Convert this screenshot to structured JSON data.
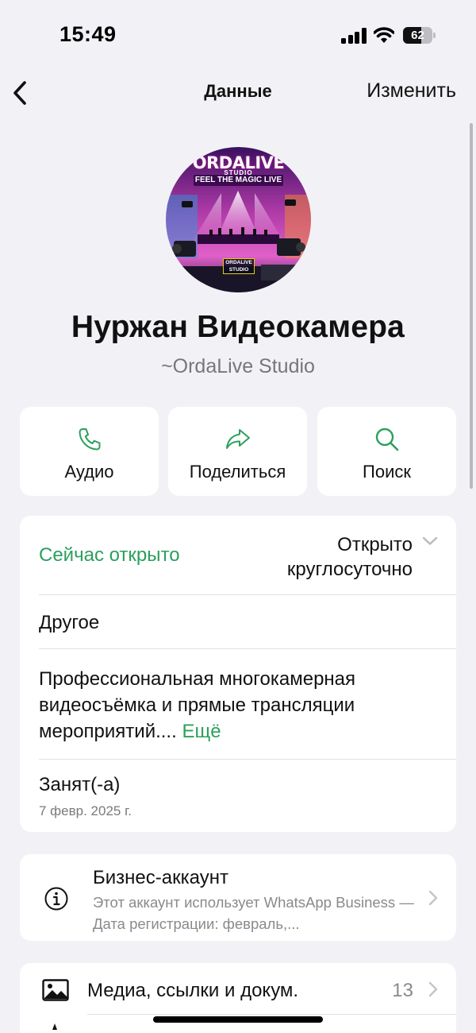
{
  "status_bar": {
    "time": "15:49",
    "battery_level": "62",
    "battery_fraction": 0.62
  },
  "nav": {
    "title": "Данные",
    "edit_label": "Изменить"
  },
  "avatar": {
    "logo_text": "ORDALIVE",
    "logo_sub": "STUDIO",
    "tagline": "FEEL THE MAGIC LIVE",
    "badge_line1": "ORDALIVE",
    "badge_line2": "STUDIO"
  },
  "contact": {
    "name": "Нуржан Видеокамера",
    "subtitle": "~OrdaLive Studio"
  },
  "actions": [
    {
      "label": "Аудио",
      "icon": "phone-icon"
    },
    {
      "label": "Поделиться",
      "icon": "share-icon"
    },
    {
      "label": "Поиск",
      "icon": "search-icon"
    }
  ],
  "info": {
    "open_status": "Сейчас открыто",
    "hours_line1": "Открыто",
    "hours_line2": "круглосуточно",
    "category": "Другое",
    "description": "Профессиональная многокамерная видеосъёмка и прямые трансляции мероприятий....",
    "more_label": "Ещё",
    "busy_label": "Занят(-а)",
    "busy_date": "7 февр. 2025 г."
  },
  "business": {
    "title": "Бизнес-аккаунт",
    "text": "Этот аккаунт использует WhatsApp Business — Дата регистрации: февраль,..."
  },
  "media": {
    "label": "Медиа, ссылки и докум.",
    "count": "13"
  },
  "colors": {
    "accent": "#2c9f5c",
    "background": "#f2f2f6",
    "card": "#ffffff",
    "secondary_text": "#8a8a8e"
  }
}
